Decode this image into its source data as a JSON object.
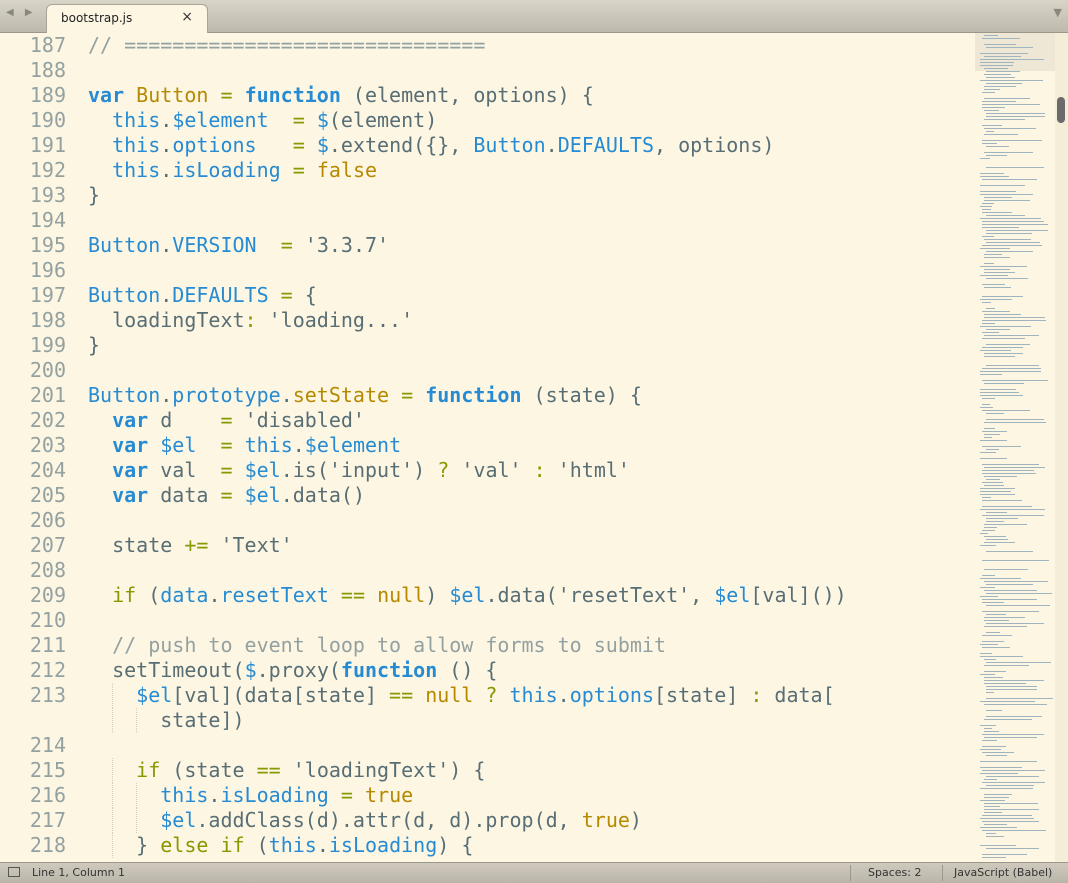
{
  "tabbar": {
    "arrows": "◀ ▶",
    "tab_title": "bootstrap.js",
    "close": "×",
    "dropdown": "▼"
  },
  "editor": {
    "line_numbers": [
      "187",
      "188",
      "189",
      "190",
      "191",
      "192",
      "193",
      "194",
      "195",
      "196",
      "197",
      "198",
      "199",
      "200",
      "201",
      "202",
      "203",
      "204",
      "205",
      "206",
      "207",
      "208",
      "209",
      "210",
      "211",
      "212",
      "213",
      "",
      "214",
      "215",
      "216",
      "217",
      "218"
    ],
    "lines": [
      "// ==============================",
      "",
      "var Button = function (element, options) {",
      "  this.$element  = $(element)",
      "  this.options   = $.extend({}, Button.DEFAULTS, options)",
      "  this.isLoading = false",
      "}",
      "",
      "Button.VERSION  = '3.3.7'",
      "",
      "Button.DEFAULTS = {",
      "  loadingText: 'loading...'",
      "}",
      "",
      "Button.prototype.setState = function (state) {",
      "  var d    = 'disabled'",
      "  var $el  = this.$element",
      "  var val  = $el.is('input') ? 'val' : 'html'",
      "  var data = $el.data()",
      "",
      "  state += 'Text'",
      "",
      "  if (data.resetText == null) $el.data('resetText', $el[val]())",
      "",
      "  // push to event loop to allow forms to submit",
      "  setTimeout($.proxy(function () {",
      "    $el[val](data[state] == null ? this.options[state] : data[",
      "      state])",
      "",
      "    if (state == 'loadingText') {",
      "      this.isLoading = true",
      "      $el.addClass(d).attr(d, d).prop(d, true)",
      "    } else if (this.isLoading) {"
    ]
  },
  "statusbar": {
    "position": "Line 1, Column 1",
    "spaces": "Spaces: 2",
    "syntax": "JavaScript (Babel)"
  },
  "colors": {
    "background": "#fdf6e3",
    "keyword": "#268bd2",
    "function_name": "#b58900",
    "control": "#859900",
    "comment": "#93a1a1",
    "text": "#586e75"
  }
}
